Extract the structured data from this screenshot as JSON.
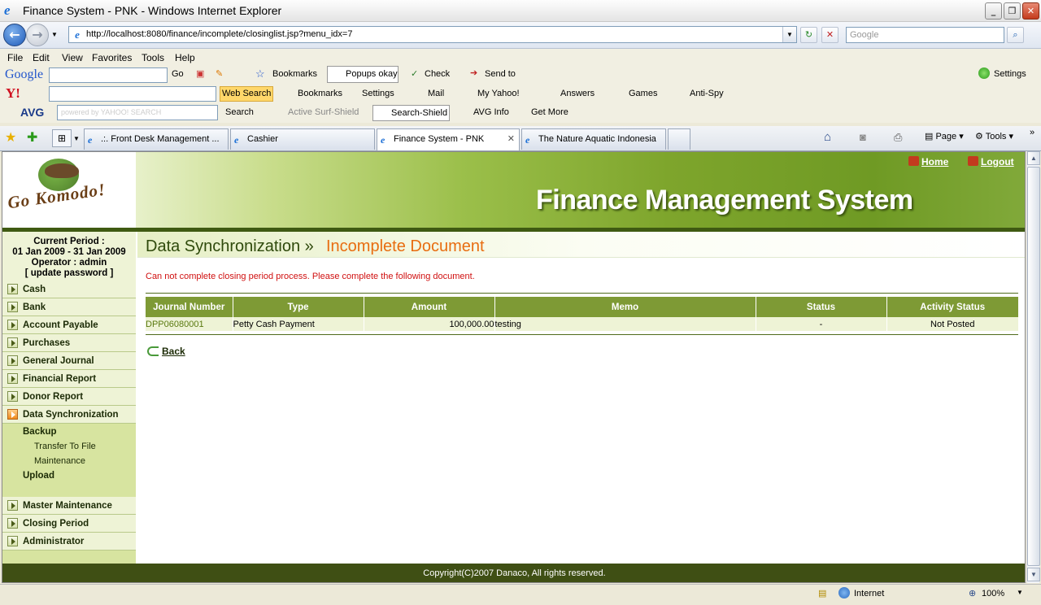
{
  "window": {
    "title": "Finance System - PNK - Windows Internet Explorer"
  },
  "address": {
    "url": "http://localhost:8080/finance/incomplete/closinglist.jsp?menu_idx=7",
    "search_placeholder": "Google"
  },
  "menubar": [
    "File",
    "Edit",
    "View",
    "Favorites",
    "Tools",
    "Help"
  ],
  "google_toolbar": {
    "brand": "Google",
    "go": "Go",
    "bookmarks": "Bookmarks",
    "popups": "Popups okay",
    "check": "Check",
    "send_to": "Send to",
    "settings": "Settings"
  },
  "yahoo_toolbar": {
    "brand": "Y!",
    "web_search": "Web Search",
    "bookmarks": "Bookmarks",
    "settings": "Settings",
    "mail": "Mail",
    "my_yahoo": "My Yahoo!",
    "answers": "Answers",
    "games": "Games",
    "anti_spy": "Anti-Spy"
  },
  "avg_toolbar": {
    "brand": "AVG",
    "search_placeholder": "powered by YAHOO! SEARCH",
    "search": "Search",
    "active_surf": "Active  Surf-Shield",
    "search_shield": "Search-Shield",
    "avg_info": "AVG Info",
    "get_more": "Get More"
  },
  "tabs": [
    {
      "label": ".:. Front Desk Management ..."
    },
    {
      "label": "Cashier"
    },
    {
      "label": "Finance System - PNK",
      "active": true
    },
    {
      "label": "The Nature Aquatic Indonesia"
    }
  ],
  "command_bar": {
    "page": "Page",
    "tools": "Tools"
  },
  "banner": {
    "logo_text": "Go Komodo!",
    "title": "Finance Management System",
    "home": "Home",
    "logout": "Logout"
  },
  "sidebar": {
    "period_label": "Current Period :",
    "period_range": "01 Jan 2009 - 31 Jan 2009",
    "operator": "Operator : admin",
    "update_password": "[ update password ]",
    "items_top": [
      "Cash",
      "Bank",
      "Account Payable",
      "Purchases",
      "General Journal",
      "Financial Report",
      "Donor Report",
      "Data Synchronization"
    ],
    "sub": {
      "backup": "Backup",
      "transfer": "Transfer To File",
      "maintenance": "Maintenance",
      "upload": "Upload"
    },
    "items_bottom": [
      "Master Maintenance",
      "Closing Period",
      "Administrator"
    ]
  },
  "content": {
    "title_main": "Data Synchronization »",
    "title_sub": "Incomplete Document",
    "message": "Can not complete closing period process. Please complete the following document.",
    "columns": [
      "Journal Number",
      "Type",
      "Amount",
      "Memo",
      "Status",
      "Activity Status"
    ],
    "rows": [
      {
        "journal": "DPP06080001",
        "type": "Petty Cash Payment",
        "amount": "100,000.00",
        "memo": "testing",
        "status": "-",
        "activity": "Not Posted"
      }
    ],
    "back": "Back"
  },
  "footer": "Copyright(C)2007 Danaco, All rights reserved.",
  "statusbar": {
    "zone": "Internet",
    "zoom": "100%"
  },
  "colors": {
    "accent": "#7e9a35",
    "title_orange": "#e86d10",
    "error": "#d01010",
    "footer": "#3f4f14"
  }
}
